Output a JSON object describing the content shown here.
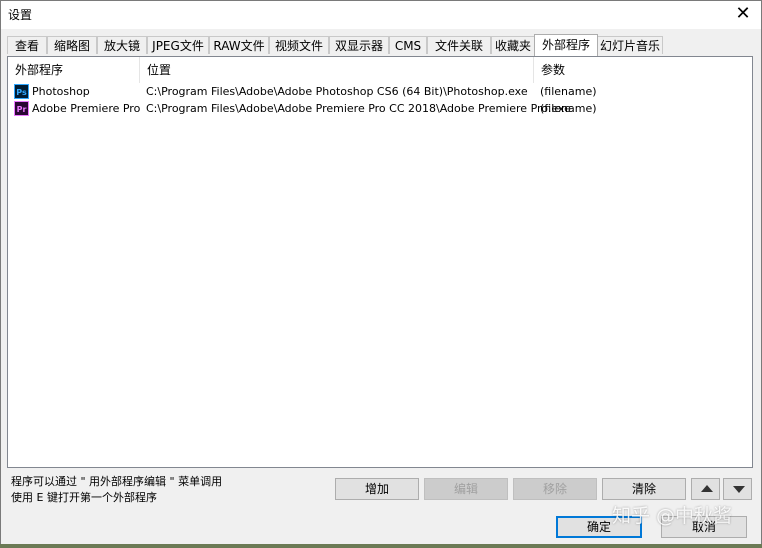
{
  "window": {
    "title": "设置",
    "close_glyph": "✕"
  },
  "tabs": [
    {
      "label": "查看"
    },
    {
      "label": "缩略图"
    },
    {
      "label": "放大镜"
    },
    {
      "label": "JPEG文件"
    },
    {
      "label": "RAW文件"
    },
    {
      "label": "视频文件"
    },
    {
      "label": "双显示器"
    },
    {
      "label": "CMS"
    },
    {
      "label": "文件关联"
    },
    {
      "label": "收藏夹"
    },
    {
      "label": "外部程序",
      "active": true
    },
    {
      "label": "幻灯片音乐"
    }
  ],
  "list": {
    "columns": [
      "外部程序",
      "位置",
      "参数"
    ],
    "rows": [
      {
        "icon": "photoshop-icon",
        "icon_text": "Ps",
        "name": "Photoshop",
        "path": "C:\\Program Files\\Adobe\\Adobe Photoshop CS6 (64 Bit)\\Photoshop.exe",
        "args": "(filename)"
      },
      {
        "icon": "premiere-pro-icon",
        "icon_text": "Pr",
        "name": "Adobe Premiere Pro",
        "path": "C:\\Program Files\\Adobe\\Adobe Premiere Pro CC 2018\\Adobe Premiere Pro.exe",
        "args": "(filename)"
      }
    ]
  },
  "hints": {
    "line1": "程序可以通过 \" 用外部程序编辑 \" 菜单调用",
    "line2": "使用 E 键打开第一个外部程序"
  },
  "buttons": {
    "add": "增加",
    "edit": "编辑",
    "remove": "移除",
    "clear": "清除",
    "ok": "确定",
    "cancel": "取消"
  },
  "watermark": "知乎 @中秋酱"
}
